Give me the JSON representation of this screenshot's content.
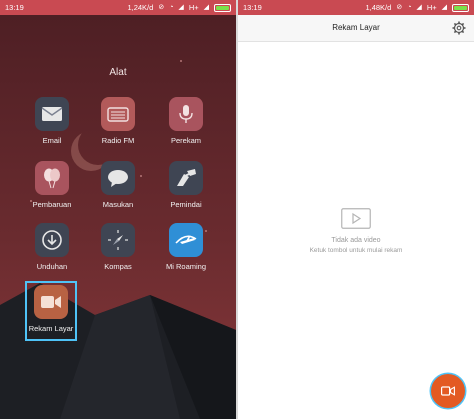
{
  "left_screen": {
    "status": {
      "time": "13:19",
      "speed": "1,24K/d",
      "network": "H+"
    },
    "folder_title": "Alat",
    "apps": [
      {
        "label": "Email",
        "icon": "email-icon"
      },
      {
        "label": "Radio FM",
        "icon": "radio-icon"
      },
      {
        "label": "Perekam",
        "icon": "microphone-icon"
      },
      {
        "label": "Pembaruan",
        "icon": "balloons-icon"
      },
      {
        "label": "Masukan",
        "icon": "chat-bubble-icon"
      },
      {
        "label": "Pemindai",
        "icon": "scanner-icon"
      },
      {
        "label": "Unduhan",
        "icon": "download-icon"
      },
      {
        "label": "Kompas",
        "icon": "compass-icon"
      },
      {
        "label": "Mi Roaming",
        "icon": "airplane-icon"
      },
      {
        "label": "Rekam Layar",
        "icon": "video-camera-icon"
      }
    ]
  },
  "right_screen": {
    "status": {
      "time": "13:19",
      "speed": "1,48K/d",
      "network": "H+"
    },
    "title": "Rekam Layar",
    "empty_title": "Tidak ada video",
    "empty_subtitle": "Ketuk tombol untuk mulai rekam"
  },
  "colors": {
    "status_bar": "#c94a52",
    "wallpaper": "#5c2629",
    "selection": "#4fc3f7",
    "record_button": "#e35a23"
  }
}
